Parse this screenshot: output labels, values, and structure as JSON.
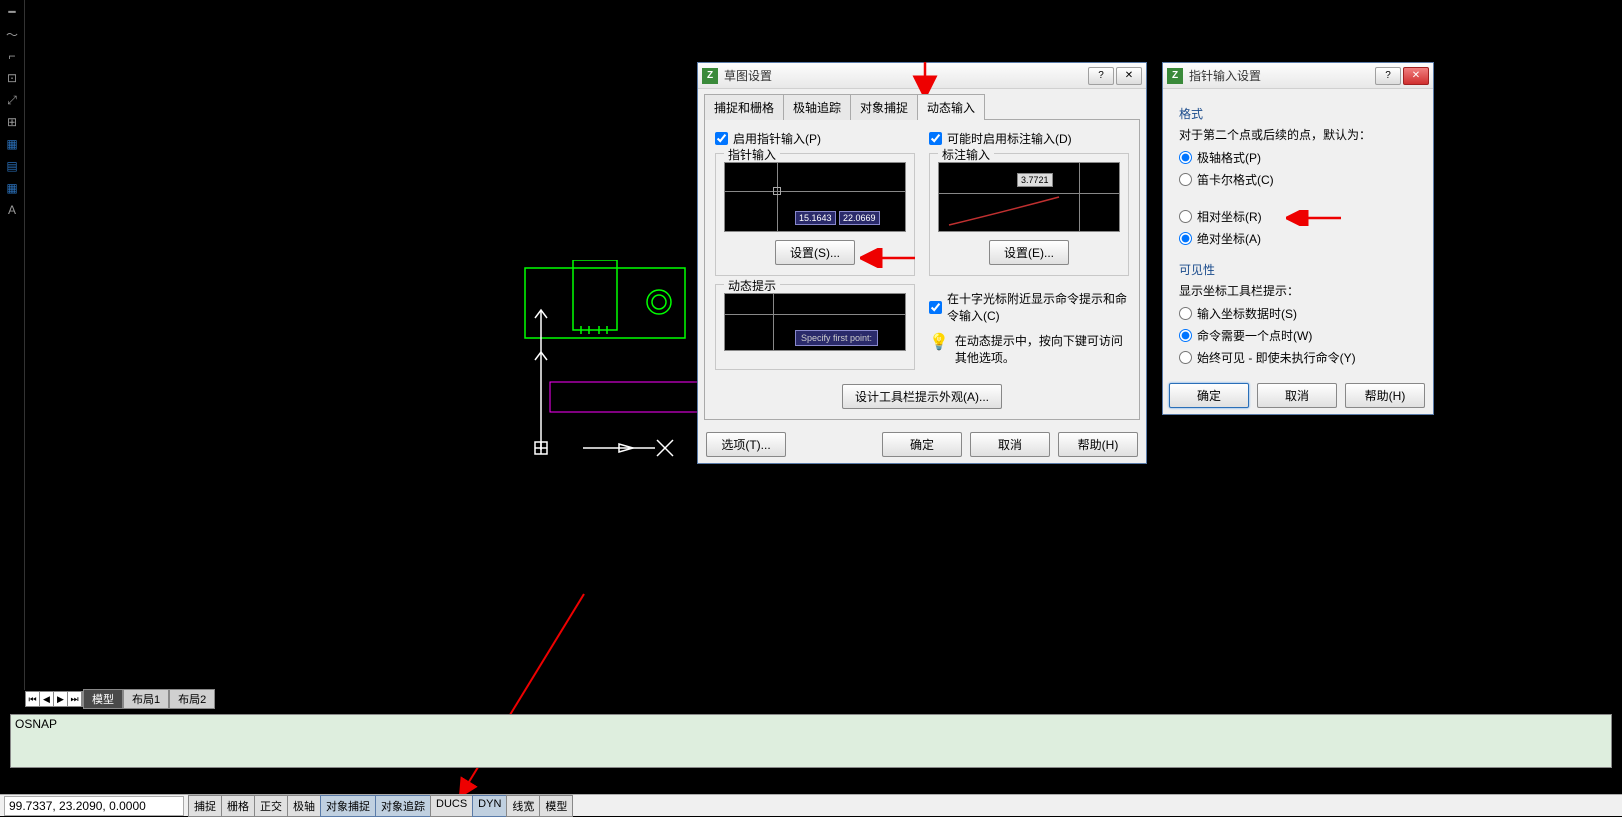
{
  "toolbar_icons": [
    "tool-line",
    "tool-spline",
    "tool-pline",
    "tool-rect",
    "tool-scale",
    "tool-group",
    "tool-hatch",
    "tool-dim",
    "tool-table",
    "tool-text"
  ],
  "dialog_main": {
    "title": "草图设置",
    "tabs": [
      "捕捉和栅格",
      "极轴追踪",
      "对象捕捉",
      "动态输入"
    ],
    "active_tab": 3,
    "left": {
      "checkbox": "启用指针输入(P)",
      "group": "指针输入",
      "coord1": "15.1643",
      "coord2": "22.0669",
      "btn": "设置(S)..."
    },
    "right": {
      "checkbox": "可能时启用标注输入(D)",
      "group": "标注输入",
      "value": "3.7721",
      "btn": "设置(E)..."
    },
    "hint": {
      "group": "动态提示",
      "label": "Specify first point:",
      "chk": "在十字光标附近显示命令提示和命令输入(C)",
      "note": "在动态提示中，按向下键可访问其他选项。"
    },
    "appearance_btn": "设计工具栏提示外观(A)...",
    "options_btn": "选项(T)...",
    "ok": "确定",
    "cancel": "取消",
    "help": "帮助(H)"
  },
  "dialog_sub": {
    "title": "指针输入设置",
    "section_format": "格式",
    "format_desc": "对于第二个点或后续的点，默认为：",
    "fmt_polar": "极轴格式(P)",
    "fmt_cart": "笛卡尔格式(C)",
    "coord_rel": "相对坐标(R)",
    "coord_abs": "绝对坐标(A)",
    "section_vis": "可见性",
    "vis_desc": "显示坐标工具栏提示：",
    "vis_1": "输入坐标数据时(S)",
    "vis_2": "命令需要一个点时(W)",
    "vis_3": "始终可见 - 即使未执行命令(Y)",
    "ok": "确定",
    "cancel": "取消",
    "help": "帮助(H)"
  },
  "bottom_tabs": {
    "model": "模型",
    "layout1": "布局1",
    "layout2": "布局2"
  },
  "cmd_text": "OSNAP",
  "coords": "99.7337, 23.2090, 0.0000",
  "status_btns": [
    "捕捉",
    "栅格",
    "正交",
    "极轴",
    "对象捕捉",
    "对象追踪",
    "DUCS",
    "DYN",
    "线宽",
    "模型"
  ]
}
